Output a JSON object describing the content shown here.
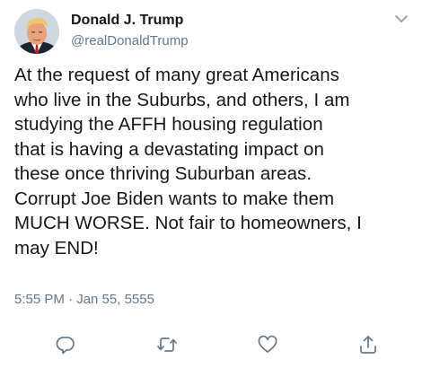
{
  "author": {
    "display_name": "Donald J. Trump",
    "handle": "@realDonaldTrump",
    "avatar": "profile-photo"
  },
  "tweet": {
    "text": "At the request of many great Americans\nwho live in the Suburbs, and others, I am\nstudying the AFFH housing regulation\nthat is having a devastating impact on\nthese once thriving Suburban areas.\nCorrupt Joe Biden wants to make them\nMUCH WORSE. Not fair to homeowners, I\nmay END!",
    "timestamp": "5:55 PM · Jan 55, 5555"
  },
  "icons": {
    "menu": "chevron-down-icon",
    "reply": "reply-icon",
    "retweet": "retweet-icon",
    "like": "heart-icon",
    "share": "share-icon"
  },
  "colors": {
    "text": "#14171a",
    "secondary": "#657786",
    "icon": "#657786"
  }
}
